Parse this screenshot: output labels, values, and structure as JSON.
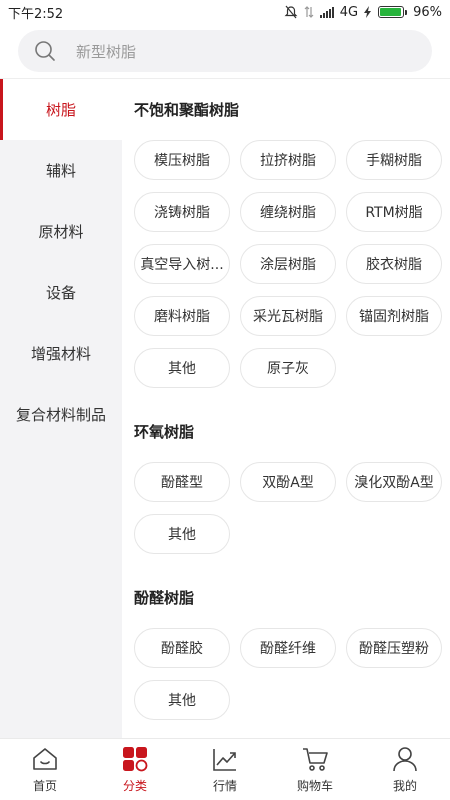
{
  "status": {
    "time": "下午2:52",
    "network": "4G",
    "battery": "96%",
    "battery_level": 0.96,
    "colors": {
      "battery_fill": "#27b43c"
    }
  },
  "search": {
    "placeholder": "新型树脂",
    "icon": "search-icon"
  },
  "sidebar": {
    "items": [
      {
        "label": "树脂",
        "active": true
      },
      {
        "label": "辅料"
      },
      {
        "label": "原材料"
      },
      {
        "label": "设备"
      },
      {
        "label": "增强材料"
      },
      {
        "label": "复合材料制品"
      }
    ]
  },
  "sections": [
    {
      "title": "不饱和聚酯树脂",
      "chips": [
        "模压树脂",
        "拉挤树脂",
        "手糊树脂",
        "浇铸树脂",
        "缠绕树脂",
        "RTM树脂",
        "真空导入树...",
        "涂层树脂",
        "胶衣树脂",
        "磨料树脂",
        "采光瓦树脂",
        "锚固剂树脂",
        "其他",
        "原子灰"
      ]
    },
    {
      "title": "环氧树脂",
      "chips": [
        "酚醛型",
        "双酚A型",
        "溴化双酚A型",
        "其他"
      ]
    },
    {
      "title": "酚醛树脂",
      "chips": [
        "酚醛胶",
        "酚醛纤维",
        "酚醛压塑粉",
        "其他"
      ]
    }
  ],
  "tabbar": {
    "items": [
      {
        "label": "首页",
        "icon": "home-icon"
      },
      {
        "label": "分类",
        "icon": "category-icon",
        "active": true
      },
      {
        "label": "行情",
        "icon": "trend-icon"
      },
      {
        "label": "购物车",
        "icon": "cart-icon"
      },
      {
        "label": "我的",
        "icon": "user-icon"
      }
    ]
  },
  "colors": {
    "accent": "#c8161d",
    "sidebar_bg": "#f3f3f5",
    "search_bg": "#f2f2f4"
  }
}
